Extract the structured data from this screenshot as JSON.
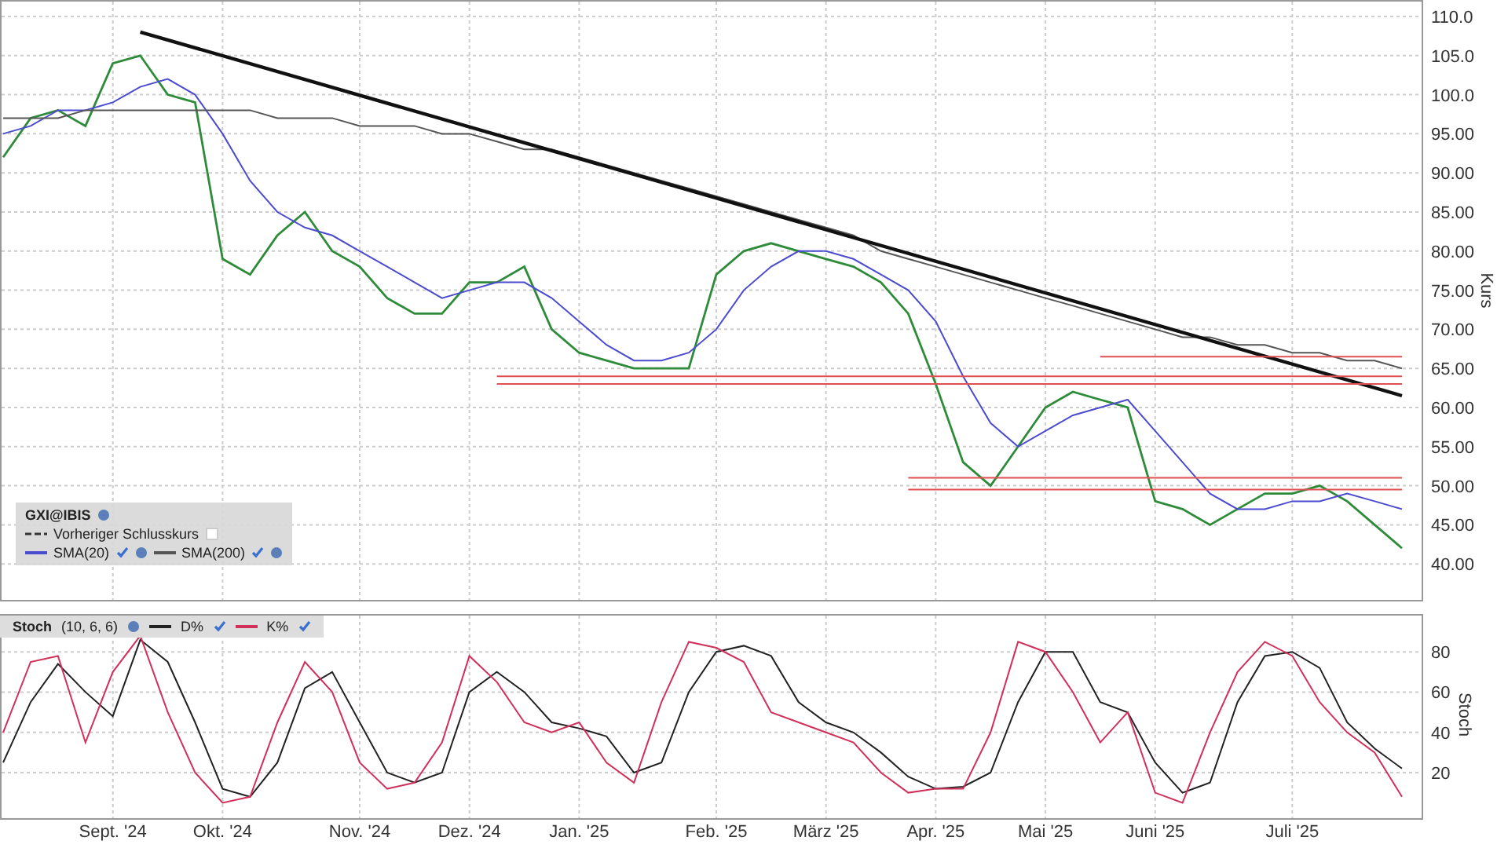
{
  "price_pane": {
    "legend_note": {
      "label": "Vorheriger Schlusskurs",
      "checked": false
    },
    "chart_data": {
      "type": "line",
      "ylabel": "Kurs",
      "categories": [
        null,
        null,
        null,
        null,
        null,
        null,
        null,
        null,
        null,
        null,
        null,
        null,
        null,
        null,
        null,
        null,
        null,
        null,
        null,
        null,
        null,
        null,
        null,
        null,
        null,
        null,
        null,
        null,
        null,
        null,
        null,
        null,
        null,
        null,
        null,
        null,
        null,
        null,
        null,
        null,
        null,
        null,
        null,
        null,
        null,
        null,
        null,
        null,
        null,
        null,
        null,
        null
      ],
      "ylim": [
        35.3,
        112
      ],
      "yticks": [
        {
          "value": 110,
          "label": "110.0"
        },
        {
          "value": 105,
          "label": "105.0"
        },
        {
          "value": 100,
          "label": "100.0"
        },
        {
          "value": 95,
          "label": "95.00"
        },
        {
          "value": 90,
          "label": "90.00"
        },
        {
          "value": 85,
          "label": "85.00"
        },
        {
          "value": 80,
          "label": "80.00"
        },
        {
          "value": 75,
          "label": "75.00"
        },
        {
          "value": 70,
          "label": "70.00"
        },
        {
          "value": 65,
          "label": "65.00"
        },
        {
          "value": 60,
          "label": "60.00"
        },
        {
          "value": 55,
          "label": "55.00"
        },
        {
          "value": 50,
          "label": "50.00"
        },
        {
          "value": 45,
          "label": "45.00"
        },
        {
          "value": 40,
          "label": "40.00"
        }
      ],
      "series": [
        {
          "name": "GXI@IBIS",
          "color": "#2e8b3a",
          "values": [
            92,
            97,
            98,
            96,
            104,
            105,
            100,
            99,
            79,
            77,
            82,
            85,
            80,
            78,
            74,
            72,
            72,
            76,
            76,
            78,
            70,
            67,
            66,
            65,
            65,
            65,
            77,
            80,
            81,
            80,
            79,
            78,
            76,
            72,
            63,
            53,
            50,
            55,
            60,
            62,
            61,
            60,
            48,
            47,
            45,
            47,
            49,
            49,
            50,
            48,
            45,
            42
          ]
        },
        {
          "name": "SMA(20)",
          "color": "#4b4bd0",
          "values": [
            95,
            96,
            98,
            98,
            99,
            101,
            102,
            100,
            95,
            89,
            85,
            83,
            82,
            80,
            78,
            76,
            74,
            75,
            76,
            76,
            74,
            71,
            68,
            66,
            66,
            67,
            70,
            75,
            78,
            80,
            80,
            79,
            77,
            75,
            71,
            64,
            58,
            55,
            57,
            59,
            60,
            61,
            57,
            53,
            49,
            47,
            47,
            48,
            48,
            49,
            48,
            47
          ]
        },
        {
          "name": "SMA(200)",
          "color": "#555555",
          "values": [
            97,
            97,
            97,
            98,
            98,
            98,
            98,
            98,
            98,
            98,
            97,
            97,
            97,
            96,
            96,
            96,
            95,
            95,
            94,
            93,
            93,
            92,
            91,
            90,
            89,
            88,
            87,
            86,
            85,
            84,
            83,
            82,
            80,
            79,
            78,
            77,
            76,
            75,
            74,
            73,
            72,
            71,
            70,
            69,
            69,
            68,
            68,
            67,
            67,
            66,
            66,
            65
          ]
        },
        {
          "color": "#111111",
          "values": [
            null,
            null,
            null,
            null,
            null,
            108,
            null,
            null,
            null,
            null,
            null,
            null,
            null,
            null,
            null,
            null,
            null,
            null,
            null,
            null,
            null,
            null,
            null,
            null,
            null,
            null,
            null,
            null,
            null,
            null,
            null,
            null,
            null,
            null,
            null,
            null,
            null,
            null,
            null,
            null,
            null,
            null,
            null,
            null,
            null,
            null,
            null,
            null,
            null,
            null,
            null,
            61.5
          ]
        },
        {
          "color": "#e05050",
          "values": [
            null,
            null,
            null,
            null,
            null,
            null,
            null,
            null,
            null,
            null,
            null,
            null,
            null,
            null,
            null,
            null,
            null,
            null,
            null,
            null,
            null,
            null,
            null,
            null,
            null,
            null,
            null,
            null,
            null,
            null,
            null,
            null,
            null,
            null,
            null,
            null,
            null,
            null,
            null,
            null,
            66.5,
            66.5,
            66.5,
            66.5,
            66.5,
            66.5,
            66.5,
            66.5,
            66.5,
            66.5,
            66.5,
            66.5
          ]
        },
        {
          "color": "#e05050",
          "values": [
            null,
            null,
            null,
            null,
            null,
            null,
            null,
            null,
            null,
            null,
            null,
            null,
            null,
            null,
            null,
            null,
            null,
            null,
            64,
            64,
            64,
            64,
            64,
            64,
            64,
            64,
            64,
            64,
            64,
            64,
            64,
            64,
            64,
            64,
            64,
            64,
            64,
            64,
            64,
            64,
            64,
            64,
            64,
            64,
            64,
            64,
            64,
            64,
            64,
            64,
            64,
            64
          ]
        },
        {
          "color": "#e05050",
          "values": [
            null,
            null,
            null,
            null,
            null,
            null,
            null,
            null,
            null,
            null,
            null,
            null,
            null,
            null,
            null,
            null,
            null,
            null,
            63,
            63,
            63,
            63,
            63,
            63,
            63,
            63,
            63,
            63,
            63,
            63,
            63,
            63,
            63,
            63,
            63,
            63,
            63,
            63,
            63,
            63,
            63,
            63,
            63,
            63,
            63,
            63,
            63,
            63,
            63,
            63,
            63,
            63
          ]
        },
        {
          "color": "#e05050",
          "values": [
            null,
            null,
            null,
            null,
            null,
            null,
            null,
            null,
            null,
            null,
            null,
            null,
            null,
            null,
            null,
            null,
            null,
            null,
            null,
            null,
            null,
            null,
            null,
            null,
            null,
            null,
            null,
            null,
            null,
            null,
            null,
            null,
            null,
            51,
            51,
            51,
            51,
            51,
            51,
            51,
            51,
            51,
            51,
            51,
            51,
            51,
            51,
            51,
            51,
            51,
            51,
            51
          ]
        },
        {
          "color": "#e05050",
          "values": [
            null,
            null,
            null,
            null,
            null,
            null,
            null,
            null,
            null,
            null,
            null,
            null,
            null,
            null,
            null,
            null,
            null,
            null,
            null,
            null,
            null,
            null,
            null,
            null,
            null,
            null,
            null,
            null,
            null,
            null,
            null,
            null,
            null,
            49.5,
            49.5,
            49.5,
            49.5,
            49.5,
            49.5,
            49.5,
            49.5,
            49.5,
            49.5,
            49.5,
            49.5,
            49.5,
            49.5,
            49.5,
            49.5,
            49.5,
            49.5,
            49.5
          ]
        }
      ],
      "grid": true
    }
  },
  "stoch_pane": {
    "parameters": "(10, 6, 6)",
    "chart_data": {
      "type": "line",
      "title": "Stoch",
      "ylabel": "Stoch",
      "categories": [
        null,
        null,
        null,
        null,
        "Sept. '24",
        null,
        null,
        null,
        "Okt. '24",
        null,
        null,
        null,
        null,
        "Nov. '24",
        null,
        null,
        null,
        "Dez. '24",
        null,
        null,
        null,
        "Jan. '25",
        null,
        null,
        null,
        null,
        "Feb. '25",
        null,
        null,
        null,
        "März '25",
        null,
        null,
        null,
        "Apr. '25",
        null,
        null,
        null,
        "Mai '25",
        null,
        null,
        null,
        "Juni '25",
        null,
        null,
        null,
        null,
        "Juli '25",
        null,
        null,
        null,
        null
      ],
      "ylim": [
        -3,
        98.4
      ],
      "grid": true,
      "yticks": [
        20,
        40,
        60,
        80
      ],
      "series": [
        {
          "name": "D%",
          "color": "#222222",
          "values": [
            25,
            55,
            74,
            60,
            48,
            86,
            75,
            45,
            12,
            8,
            25,
            62,
            70,
            45,
            20,
            15,
            20,
            60,
            70,
            60,
            45,
            42,
            38,
            20,
            25,
            60,
            80,
            83,
            78,
            55,
            45,
            40,
            30,
            18,
            12,
            13,
            20,
            55,
            80,
            80,
            55,
            50,
            25,
            10,
            15,
            55,
            78,
            80,
            72,
            45,
            32,
            22
          ]
        },
        {
          "name": "K%",
          "color": "#d0305a",
          "values": [
            40,
            75,
            78,
            35,
            70,
            88,
            50,
            20,
            5,
            8,
            45,
            75,
            60,
            25,
            12,
            15,
            35,
            78,
            65,
            45,
            40,
            45,
            25,
            15,
            55,
            85,
            82,
            75,
            50,
            45,
            40,
            35,
            20,
            10,
            12,
            12,
            40,
            85,
            80,
            60,
            35,
            50,
            10,
            5,
            40,
            70,
            85,
            78,
            55,
            40,
            30,
            8
          ]
        }
      ]
    }
  }
}
